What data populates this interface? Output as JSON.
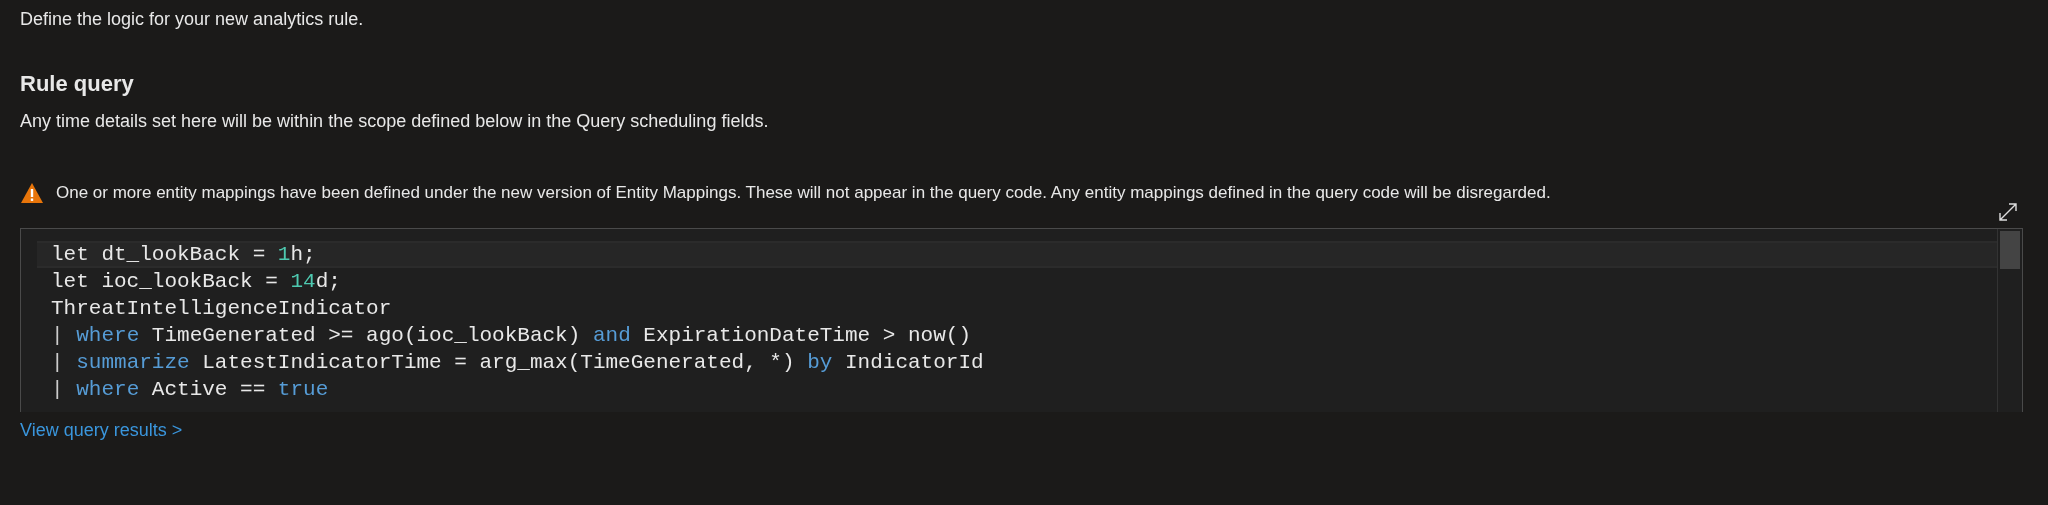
{
  "intro": "Define the logic for your new analytics rule.",
  "section": {
    "title": "Rule query",
    "description": "Any time details set here will be within the scope defined below in the Query scheduling fields."
  },
  "warning": {
    "text": "One or more entity mappings have been defined under the new version of Entity Mappings. These will not appear in the query code. Any entity mappings defined in the query code will be disregarded."
  },
  "editor": {
    "lines": [
      {
        "current": true,
        "tokens": [
          {
            "kind": "plain",
            "text": "let dt_lookBack = "
          },
          {
            "kind": "number",
            "text": "1"
          },
          {
            "kind": "plain",
            "text": "h;"
          }
        ]
      },
      {
        "current": false,
        "tokens": [
          {
            "kind": "plain",
            "text": "let ioc_lookBack = "
          },
          {
            "kind": "number",
            "text": "14"
          },
          {
            "kind": "plain",
            "text": "d;"
          }
        ]
      },
      {
        "current": false,
        "tokens": [
          {
            "kind": "plain",
            "text": "ThreatIntelligenceIndicator"
          }
        ]
      },
      {
        "current": false,
        "tokens": [
          {
            "kind": "pipe",
            "text": "| "
          },
          {
            "kind": "keyword",
            "text": "where"
          },
          {
            "kind": "plain",
            "text": " TimeGenerated >= ago(ioc_lookBack) "
          },
          {
            "kind": "keyword",
            "text": "and"
          },
          {
            "kind": "plain",
            "text": " ExpirationDateTime > now()"
          }
        ]
      },
      {
        "current": false,
        "tokens": [
          {
            "kind": "pipe",
            "text": "| "
          },
          {
            "kind": "keyword",
            "text": "summarize"
          },
          {
            "kind": "plain",
            "text": " LatestIndicatorTime = arg_max(TimeGenerated, *) "
          },
          {
            "kind": "keyword",
            "text": "by"
          },
          {
            "kind": "plain",
            "text": " IndicatorId"
          }
        ]
      },
      {
        "current": false,
        "tokens": [
          {
            "kind": "pipe",
            "text": "| "
          },
          {
            "kind": "keyword",
            "text": "where"
          },
          {
            "kind": "plain",
            "text": " Active == "
          },
          {
            "kind": "keyword",
            "text": "true"
          }
        ]
      }
    ]
  },
  "link": "View query results >"
}
